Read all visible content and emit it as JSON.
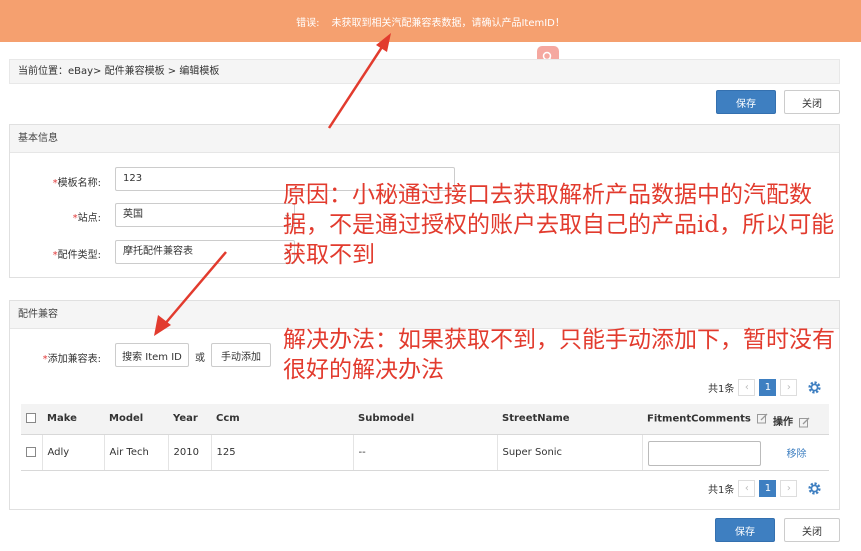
{
  "error_bar": {
    "label": "错误:",
    "message": "未获取到相关汽配兼容表数据，请确认产品ItemID！"
  },
  "breadcrumb": "当前位置：eBay> 配件兼容模板 > 编辑模板",
  "top_actions": {
    "save": "保存",
    "close": "关闭"
  },
  "basic_info": {
    "title": "基本信息",
    "fields": {
      "template_name": {
        "label": "模板名称:",
        "value": "123"
      },
      "site": {
        "label": "站点:",
        "value": "英国"
      },
      "part_type": {
        "label": "配件类型:",
        "value": "摩托配件兼容表"
      }
    }
  },
  "compat": {
    "title": "配件兼容",
    "add_label": "添加兼容表:",
    "search_button": "搜索 Item ID",
    "or_text": "或",
    "manual_button": "手动添加"
  },
  "pager": {
    "total": "共1条",
    "prev": "‹",
    "page": "1",
    "next": "›"
  },
  "table": {
    "headers": [
      "Make",
      "Model",
      "Year",
      "Ccm",
      "Submodel",
      "StreetName",
      "FitmentComments",
      "操作"
    ],
    "rows": [
      {
        "make": "Adly",
        "model": "Air Tech",
        "year": "2010",
        "ccm": "125",
        "submodel": "--",
        "street": "Super Sonic",
        "comment": "",
        "action": "移除"
      }
    ]
  },
  "bottom_actions": {
    "save": "保存",
    "close": "关闭"
  },
  "annotation": {
    "reason": "原因：小秘通过接口去获取解析产品数据中的汽配数据，不是通过授权的账户去取自己的产品id，所以可能获取不到",
    "solution": "解决办法：如果获取不到，只能手动添加下，暂时没有很好的解决办法"
  },
  "colors": {
    "error_bar": "#f5a06f",
    "primary": "#3e7fc1",
    "annotation": "#e23b2e"
  }
}
